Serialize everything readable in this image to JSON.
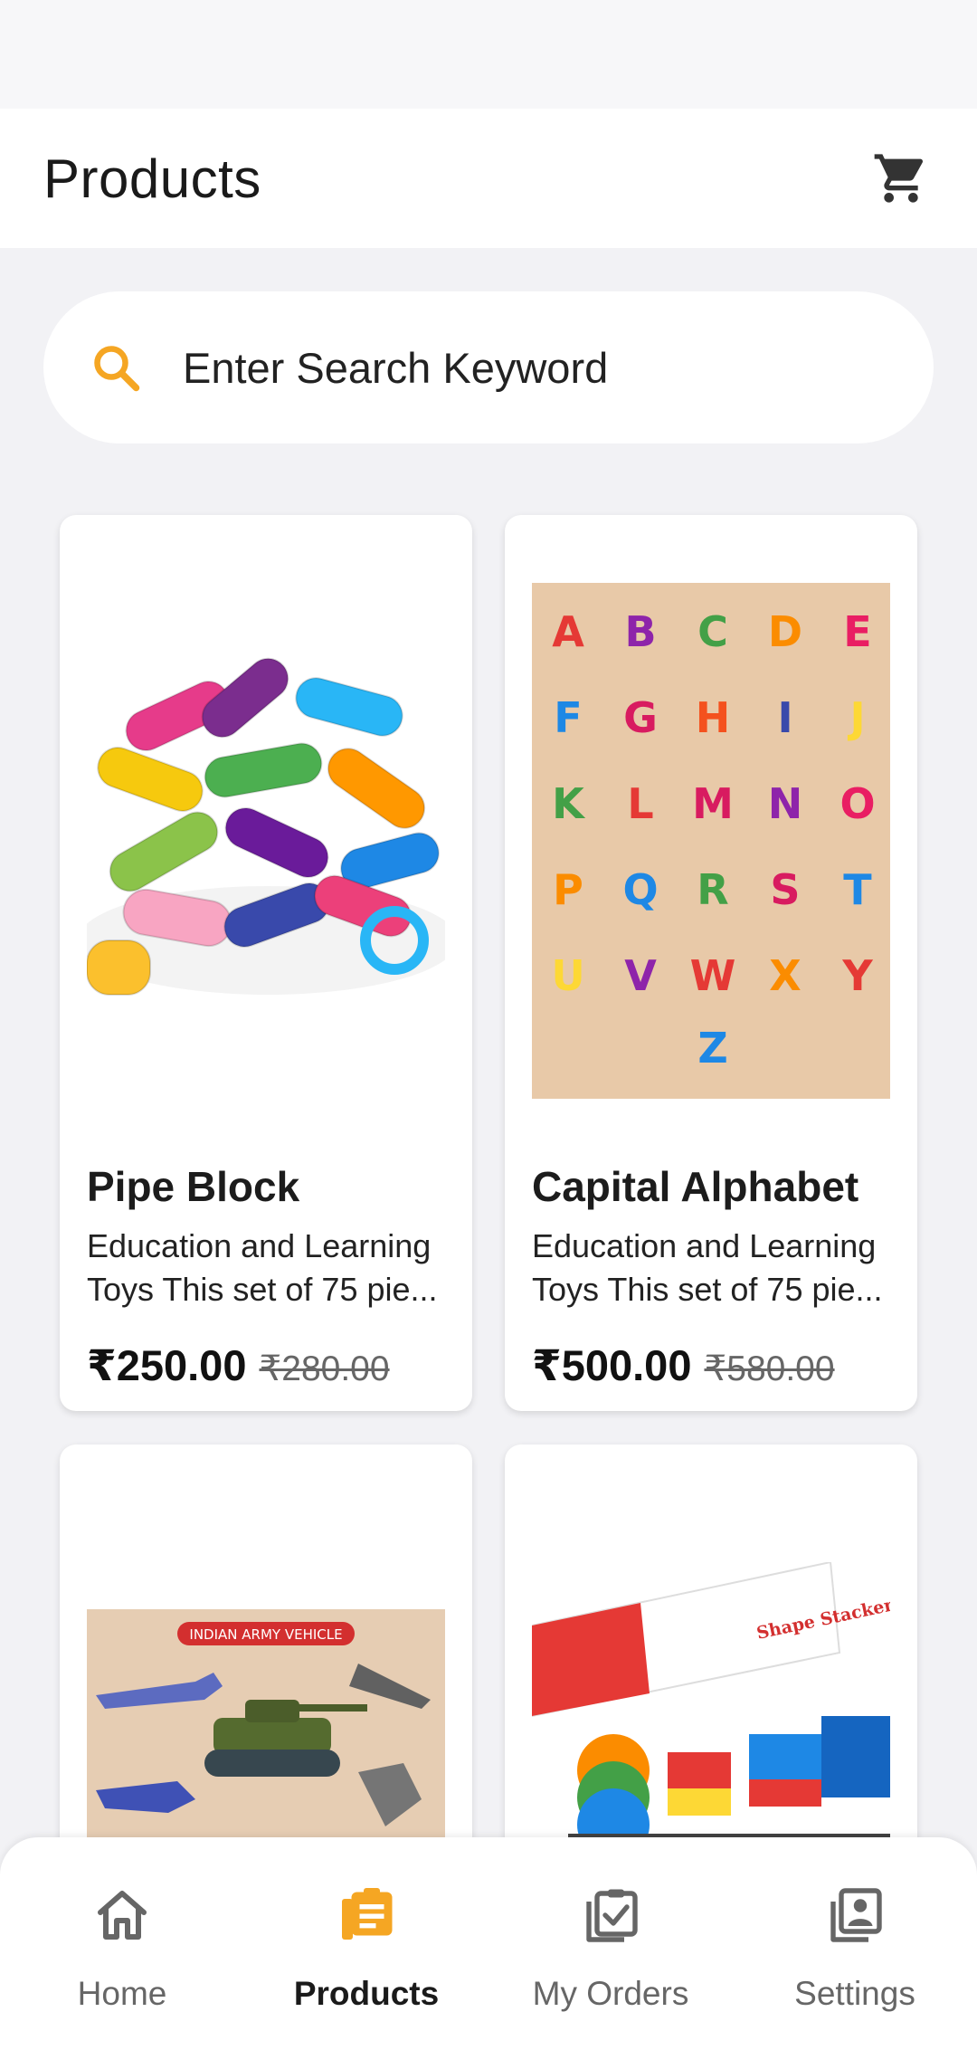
{
  "header": {
    "title": "Products"
  },
  "search": {
    "placeholder": "Enter Search Keyword",
    "value": ""
  },
  "products": [
    {
      "name": "Pipe Block",
      "desc_line1": "Education and Learning",
      "desc_line2": "Toys This set of 75 pie...",
      "price": "₹250.00",
      "old_price": "₹280.00"
    },
    {
      "name": "Capital Alphabet",
      "desc_line1": "Education and Learning",
      "desc_line2": "Toys This set of 75 pie...",
      "price": "₹500.00",
      "old_price": "₹580.00"
    },
    {
      "name": "",
      "image_label": "INDIAN ARMY VEHICLE"
    },
    {
      "name": "",
      "image_label": "Shape Stacker"
    }
  ],
  "nav": {
    "items": [
      {
        "label": "Home",
        "icon": "home-icon"
      },
      {
        "label": "Products",
        "icon": "products-icon",
        "active": true
      },
      {
        "label": "My Orders",
        "icon": "orders-icon"
      },
      {
        "label": "Settings",
        "icon": "settings-icon"
      }
    ]
  },
  "colors": {
    "accent": "#f5a623",
    "text": "#1c1c1c",
    "background": "#f2f2f5",
    "icon_gray": "#666666"
  }
}
